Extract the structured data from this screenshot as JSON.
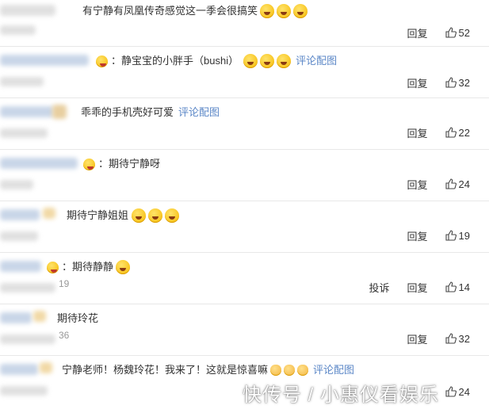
{
  "comments": [
    {
      "text": "有宁静有凤凰传奇感觉这一季会很搞笑",
      "emojis": [
        "laugh",
        "laugh",
        "laugh"
      ],
      "link": "",
      "time_tail": "",
      "report": "",
      "reply": "回复",
      "likes": "52"
    },
    {
      "text": "：静宝宝的小胖手（bushi）",
      "emojis": [
        "shock",
        "shock",
        "shock"
      ],
      "link": "评论配图",
      "time_tail": "",
      "report": "",
      "reply": "回复",
      "likes": "32"
    },
    {
      "text": "乖乖的手机壳好可爱",
      "emojis": [],
      "link": "评论配图",
      "time_tail": "",
      "report": "",
      "reply": "回复",
      "likes": "22"
    },
    {
      "text": "：期待宁静呀",
      "emojis": [],
      "link": "",
      "time_tail": "",
      "report": "",
      "reply": "回复",
      "likes": "24"
    },
    {
      "text": "期待宁静姐姐",
      "emojis": [
        "cry",
        "cry",
        "cry"
      ],
      "link": "",
      "time_tail": "",
      "report": "",
      "reply": "回复",
      "likes": "19"
    },
    {
      "text": "：期待静静",
      "emojis": [
        "cry"
      ],
      "link": "",
      "time_tail": "19",
      "report": "投诉",
      "reply": "回复",
      "likes": "14"
    },
    {
      "text": "期待玲花",
      "emojis": [],
      "link": "",
      "time_tail": "36",
      "report": "",
      "reply": "回复",
      "likes": "32"
    },
    {
      "text": "宁静老师！杨魏玲花！我来了！这就是惊喜嘛",
      "emojis": [
        "clap",
        "clap",
        "clap"
      ],
      "link": "评论配图",
      "time_tail": "",
      "report": "",
      "reply": "",
      "likes": "24"
    }
  ],
  "watermark": "快传号 / 小惠仪看娱乐"
}
